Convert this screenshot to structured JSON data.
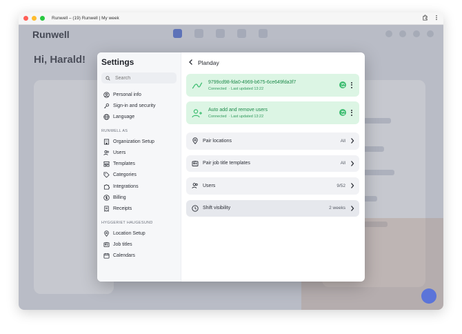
{
  "window": {
    "title": "Runwell – (19) Runwell | My week",
    "controls": {
      "close": "#ff5f57",
      "minimize": "#febc2e",
      "zoom": "#28c840"
    }
  },
  "background": {
    "logo": "Runwell",
    "greeting": "Hi, Harald!"
  },
  "settings": {
    "title": "Settings",
    "search_placeholder": "Search",
    "personal_items": [
      {
        "label": "Personal info",
        "icon": "user-circle-icon"
      },
      {
        "label": "Sign-in and security",
        "icon": "key-icon"
      },
      {
        "label": "Language",
        "icon": "globe-icon"
      }
    ],
    "org_section": "RUNWELL AS",
    "org_items": [
      {
        "label": "Organization Setup",
        "icon": "building-icon"
      },
      {
        "label": "Users",
        "icon": "users-icon"
      },
      {
        "label": "Templates",
        "icon": "template-icon"
      },
      {
        "label": "Categories",
        "icon": "tag-icon"
      },
      {
        "label": "Integrations",
        "icon": "puzzle-icon"
      },
      {
        "label": "Billing",
        "icon": "dollar-icon"
      },
      {
        "label": "Receipts",
        "icon": "receipt-icon"
      }
    ],
    "location_section": "HYGGERIET HAUGESUND",
    "location_items": [
      {
        "label": "Location Setup",
        "icon": "location-pin-icon"
      },
      {
        "label": "Job titles",
        "icon": "id-card-icon"
      },
      {
        "label": "Calendars",
        "icon": "calendar-icon"
      }
    ]
  },
  "integration": {
    "title": "Planday",
    "connections": [
      {
        "title": "9799cd98-fda0-4969-b675-6ce649fda3f7",
        "status": "Connected",
        "updated": "· Last updated 13:22",
        "icon": "link-icon"
      },
      {
        "title": "Auto add and remove users",
        "status": "Connected",
        "updated": "· Last updated 13:22",
        "icon": "user-plus-icon"
      }
    ],
    "rows": [
      {
        "label": "Pair locations",
        "value": "All",
        "icon": "location-pin-icon"
      },
      {
        "label": "Pair job title templates",
        "value": "All",
        "icon": "id-card-icon"
      },
      {
        "label": "Users",
        "value": "9/52",
        "icon": "users-icon"
      },
      {
        "label": "Shift visibility",
        "value": "2 weeks",
        "icon": "clock-icon",
        "active": true
      }
    ]
  },
  "colors": {
    "accent_green": "#1d8a4a",
    "green_card_bg": "#dcf5e4",
    "brand_blue": "#4b6bd8"
  }
}
